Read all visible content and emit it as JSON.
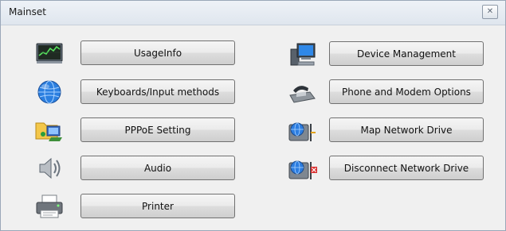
{
  "window": {
    "title": "Mainset",
    "close_label": "✕"
  },
  "left_column": [
    {
      "label": "UsageInfo",
      "icon": "performance-monitor-icon"
    },
    {
      "label": "Keyboards/Input methods",
      "icon": "globe-icon"
    },
    {
      "label": "PPPoE Setting",
      "icon": "network-folder-icon"
    },
    {
      "label": "Audio",
      "icon": "speaker-icon"
    },
    {
      "label": "Printer",
      "icon": "printer-icon"
    }
  ],
  "right_column": [
    {
      "label": "Device Management",
      "icon": "computer-icon"
    },
    {
      "label": "Phone and Modem Options",
      "icon": "phone-modem-icon"
    },
    {
      "label": "Map Network Drive",
      "icon": "map-network-drive-icon"
    },
    {
      "label": "Disconnect Network Drive",
      "icon": "disconnect-network-drive-icon"
    }
  ]
}
